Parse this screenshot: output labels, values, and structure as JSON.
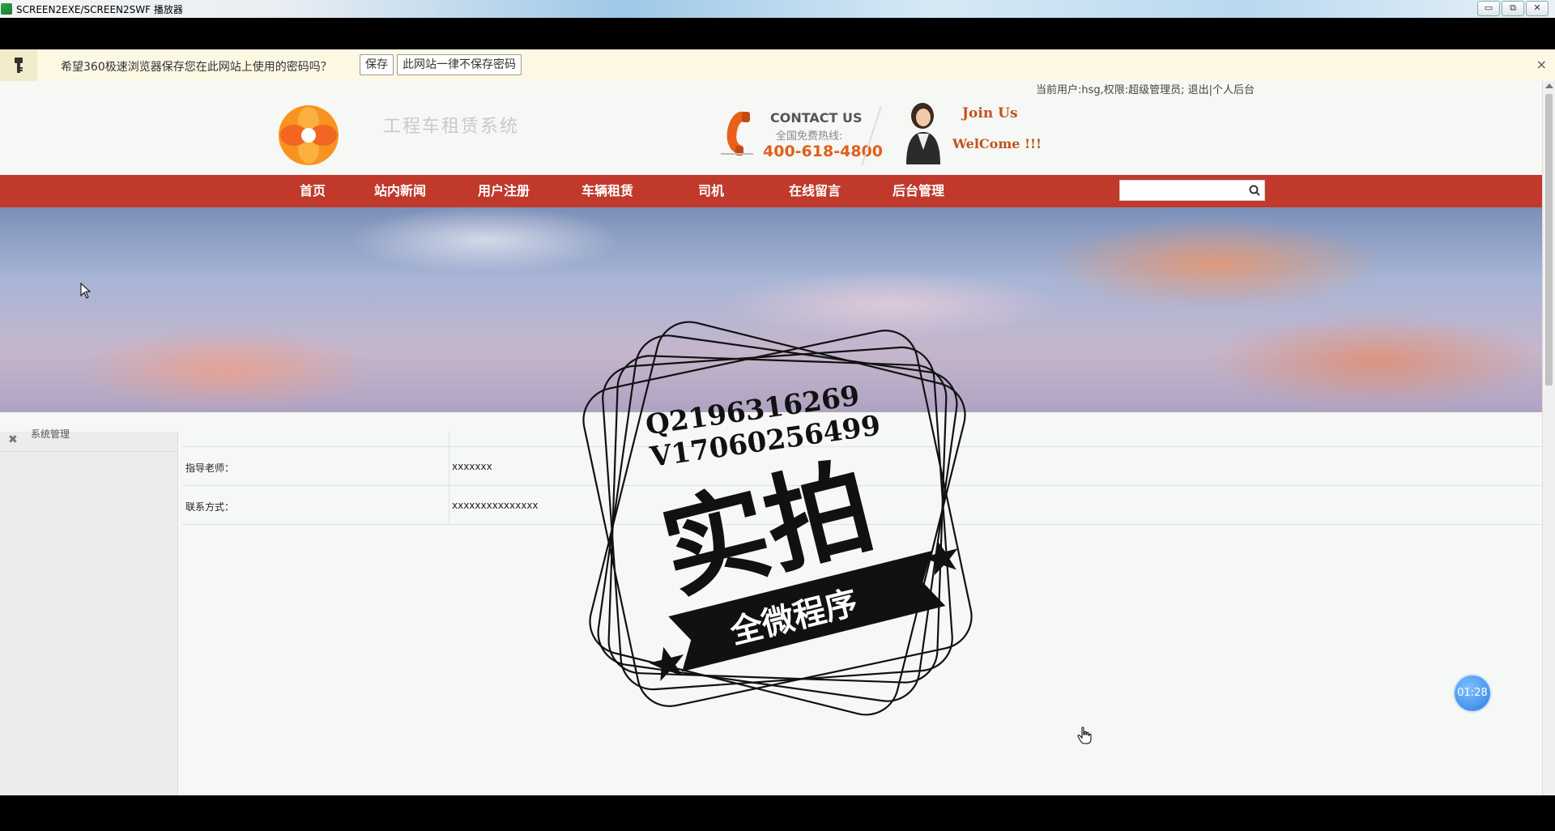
{
  "player": {
    "title": "SCREEN2EXE/SCREEN2SWF 播放器",
    "buttons": [
      "▭",
      "⧉",
      "✕"
    ]
  },
  "password_bar": {
    "message": "希望360极速浏览器保存您在此网站上使用的密码吗？",
    "save_label": "保存",
    "never_label": "此网站一律不保存密码",
    "close": "×"
  },
  "header": {
    "user_info": "当前用户:hsg,权限:超级管理员; 退出|个人后台",
    "site_name": "工程车租赁系统",
    "contact_title": "CONTACT US",
    "hotline_label": "全国免费热线:",
    "hotline": "400-618-4800",
    "join": "Join Us",
    "welcome": "WelCome !!!"
  },
  "nav": {
    "items": [
      "首页",
      "站内新闻",
      "用户注册",
      "车辆租赁",
      "司机",
      "在线留言",
      "后台管理"
    ],
    "search_placeholder": ""
  },
  "sidebar": {
    "label": "系统管理"
  },
  "table": {
    "rows": [
      {
        "label": "指导老师：",
        "value": "xxxxxxx"
      },
      {
        "label": "联系方式：",
        "value": "xxxxxxxxxxxxxxx"
      }
    ]
  },
  "watermark": {
    "line1": "Q2196316269",
    "line2": "V17060256499",
    "big": "实拍",
    "ribbon": "全微程序"
  },
  "timer": "01:28",
  "colors": {
    "nav_bg": "#c0392b",
    "hotline": "#e0601a",
    "accent_orange": "#c0541c",
    "pw_bar_bg": "#fcf8e3"
  }
}
